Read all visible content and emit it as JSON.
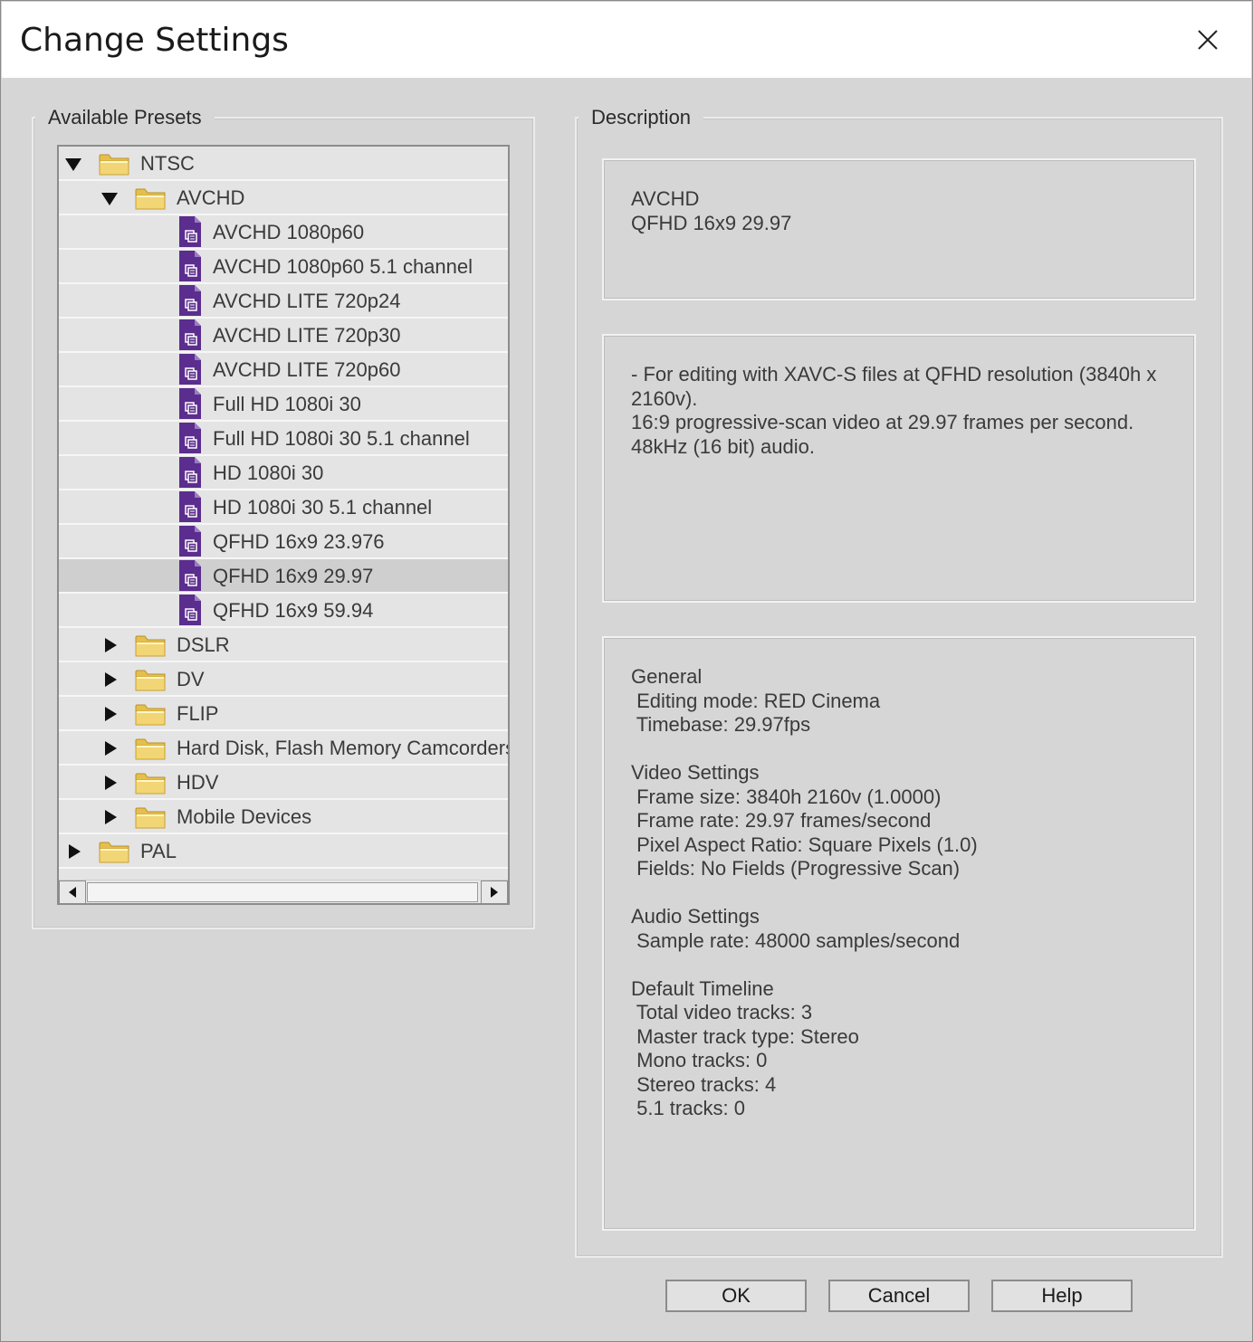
{
  "dialog": {
    "title": "Change Settings"
  },
  "presets": {
    "legend": "Available Presets",
    "tree": [
      {
        "label": "NTSC",
        "type": "folder",
        "level": 0,
        "expanded": true
      },
      {
        "label": "AVCHD",
        "type": "folder",
        "level": 1,
        "expanded": true
      },
      {
        "label": "AVCHD 1080p60",
        "type": "preset",
        "level": 2
      },
      {
        "label": "AVCHD 1080p60 5.1 channel",
        "type": "preset",
        "level": 2
      },
      {
        "label": "AVCHD LITE 720p24",
        "type": "preset",
        "level": 2
      },
      {
        "label": "AVCHD LITE 720p30",
        "type": "preset",
        "level": 2
      },
      {
        "label": "AVCHD LITE 720p60",
        "type": "preset",
        "level": 2
      },
      {
        "label": "Full HD 1080i 30",
        "type": "preset",
        "level": 2
      },
      {
        "label": "Full HD 1080i 30 5.1 channel",
        "type": "preset",
        "level": 2
      },
      {
        "label": "HD 1080i 30",
        "type": "preset",
        "level": 2
      },
      {
        "label": "HD 1080i 30 5.1 channel",
        "type": "preset",
        "level": 2
      },
      {
        "label": "QFHD 16x9 23.976",
        "type": "preset",
        "level": 2
      },
      {
        "label": "QFHD 16x9 29.97",
        "type": "preset",
        "level": 2,
        "selected": true
      },
      {
        "label": "QFHD 16x9 59.94",
        "type": "preset",
        "level": 2
      },
      {
        "label": "DSLR",
        "type": "folder",
        "level": 1,
        "expanded": false
      },
      {
        "label": "DV",
        "type": "folder",
        "level": 1,
        "expanded": false
      },
      {
        "label": "FLIP",
        "type": "folder",
        "level": 1,
        "expanded": false
      },
      {
        "label": "Hard Disk, Flash Memory Camcorders",
        "type": "folder",
        "level": 1,
        "expanded": false
      },
      {
        "label": "HDV",
        "type": "folder",
        "level": 1,
        "expanded": false
      },
      {
        "label": "Mobile Devices",
        "type": "folder",
        "level": 1,
        "expanded": false
      },
      {
        "label": "PAL",
        "type": "folder",
        "level": 0,
        "expanded": false
      }
    ]
  },
  "description": {
    "legend": "Description",
    "header_lines": [
      "AVCHD",
      "QFHD 16x9 29.97"
    ],
    "summary": "- For editing with XAVC-S files at QFHD resolution (3840h x 2160v).\n16:9 progressive-scan video at 29.97 frames per second.\n48kHz (16 bit) audio.",
    "details_lines": [
      "General",
      " Editing mode: RED Cinema",
      " Timebase: 29.97fps",
      "",
      "Video Settings",
      " Frame size: 3840h 2160v (1.0000)",
      " Frame rate: 29.97 frames/second",
      " Pixel Aspect Ratio: Square Pixels (1.0)",
      " Fields: No Fields (Progressive Scan)",
      "",
      "Audio Settings",
      " Sample rate: 48000 samples/second",
      "",
      "Default Timeline",
      " Total video tracks: 3",
      " Master track type: Stereo",
      " Mono tracks: 0",
      " Stereo tracks: 4",
      " 5.1 tracks: 0"
    ]
  },
  "buttons": {
    "ok": "OK",
    "cancel": "Cancel",
    "help": "Help"
  },
  "colors": {
    "preset_icon": "#5b2d8e",
    "folder": "#f2d675",
    "selected_row": "#cfcfcf",
    "background": "#d6d6d6"
  },
  "icons": {
    "close": "close-icon",
    "folder": "folder-icon",
    "preset": "preset-file-icon",
    "expand": "triangle-right-icon",
    "collapse": "triangle-down-icon"
  }
}
